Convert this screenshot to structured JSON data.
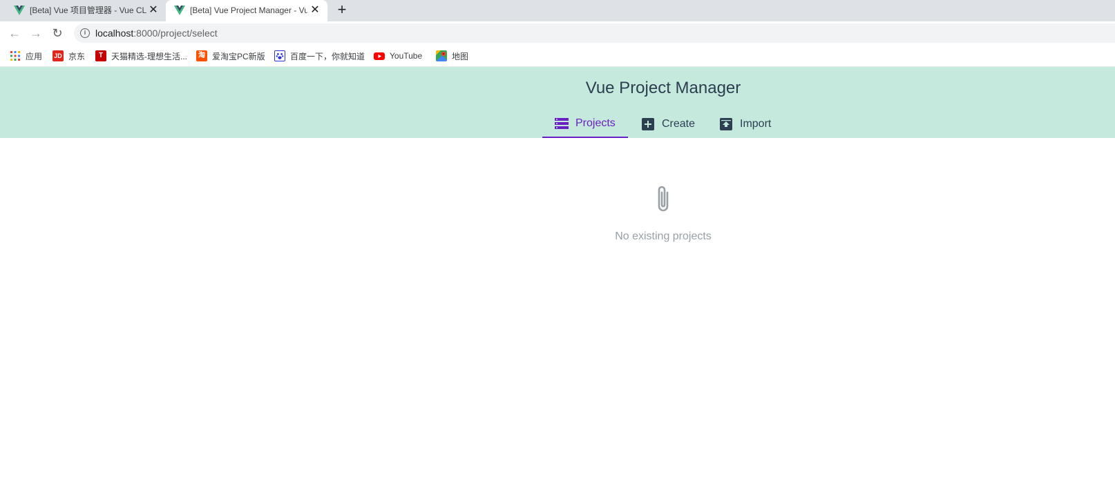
{
  "browser": {
    "tabs": [
      {
        "title": "[Beta] Vue 项目管理器 - Vue CLI",
        "active": false,
        "close": "✕"
      },
      {
        "title": "[Beta] Vue Project Manager - Vue CLI",
        "active": true,
        "close": "✕"
      }
    ],
    "new_tab": "+",
    "nav": {
      "back": "←",
      "forward": "→",
      "reload": "↻"
    },
    "url_host": "localhost",
    "url_rest": ":8000/project/select",
    "info_icon": "i"
  },
  "bookmarks": [
    {
      "label": "应用",
      "icon": "apps-grid-icon"
    },
    {
      "label": "京东",
      "icon": "jd-icon",
      "icon_text": "JD",
      "color": "#e1251b"
    },
    {
      "label": "天猫精选-理想生活...",
      "icon": "tmall-icon",
      "icon_text": "T",
      "color": "#c40000"
    },
    {
      "label": "爱淘宝PC新版",
      "icon": "taobao-icon",
      "icon_text": "淘",
      "color": "#ff5000"
    },
    {
      "label": "百度一下，你就知道",
      "icon": "baidu-icon",
      "color": "#2932e1"
    },
    {
      "label": "YouTube",
      "icon": "youtube-icon",
      "color": "#ff0000"
    },
    {
      "label": "地图",
      "icon": "maps-icon"
    }
  ],
  "app": {
    "title": "Vue Project Manager",
    "tabs": [
      {
        "label": "Projects",
        "icon": "list-icon",
        "active": true
      },
      {
        "label": "Create",
        "icon": "plus-box-icon",
        "active": false
      },
      {
        "label": "Import",
        "icon": "upload-box-icon",
        "active": false
      }
    ],
    "empty_message": "No existing projects",
    "empty_icon": "paperclip-icon",
    "colors": {
      "header_bg": "#c5e9dd",
      "accent": "#6a1fc4",
      "text": "#2c3e50",
      "muted": "#96a0a6"
    }
  }
}
